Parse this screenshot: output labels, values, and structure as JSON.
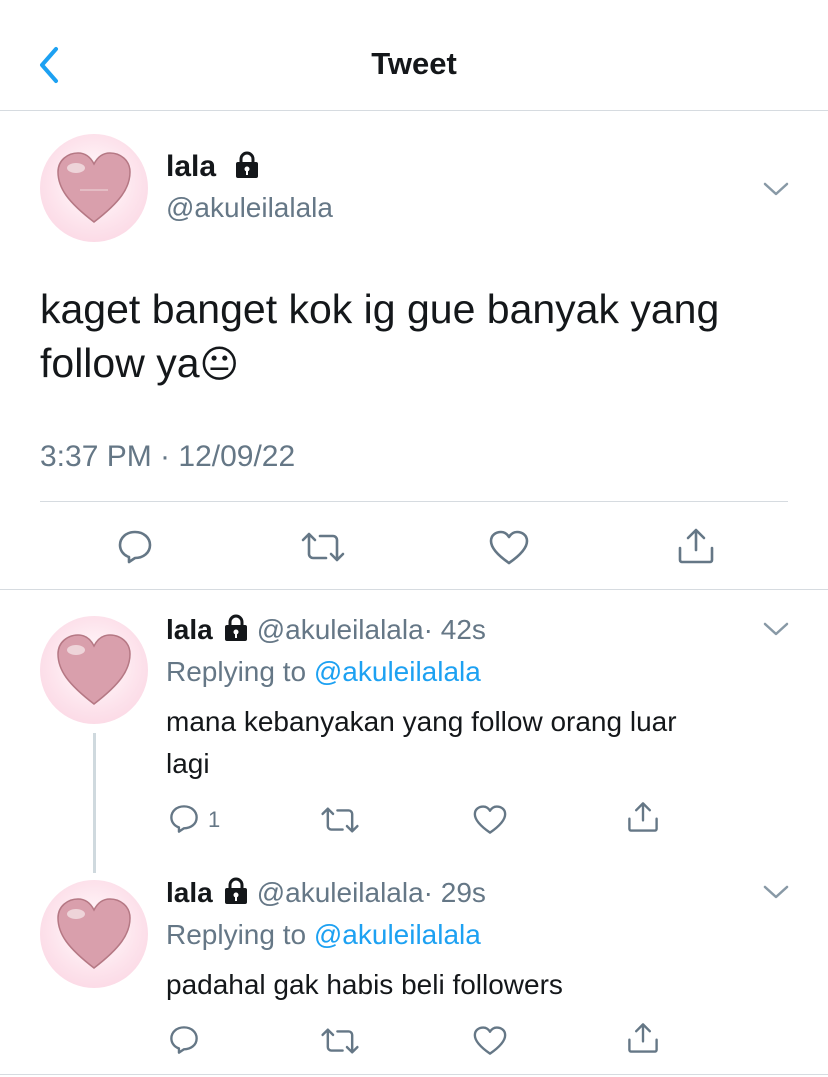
{
  "header": {
    "title": "Tweet",
    "back_icon": "chevron-left-icon"
  },
  "main_tweet": {
    "name": "lala",
    "handle": "@akuleilalala",
    "text_line1": "kaget banget kok ig gue banyak yang",
    "text_line2": "follow ya",
    "emoji": "😐",
    "timestamp": "3:37 PM · 12/09/22"
  },
  "replies": [
    {
      "name": "lala",
      "handle": "@akuleilalala",
      "time": "· 42s",
      "replying_prefix": "Replying to",
      "replying_handle": "@akuleilalala",
      "text_line1": "mana kebanyakan yang follow orang luar",
      "text_line2": "lagi",
      "reply_count": "1"
    },
    {
      "name": "lala",
      "handle": "@akuleilalala",
      "time": "· 29s",
      "replying_prefix": "Replying to",
      "replying_handle": "@akuleilalala",
      "text_line1": "padahal gak habis beli followers"
    }
  ],
  "colors": {
    "accent": "#1da1f2",
    "secondary_text": "#657786",
    "divider": "#d6dbe0"
  }
}
